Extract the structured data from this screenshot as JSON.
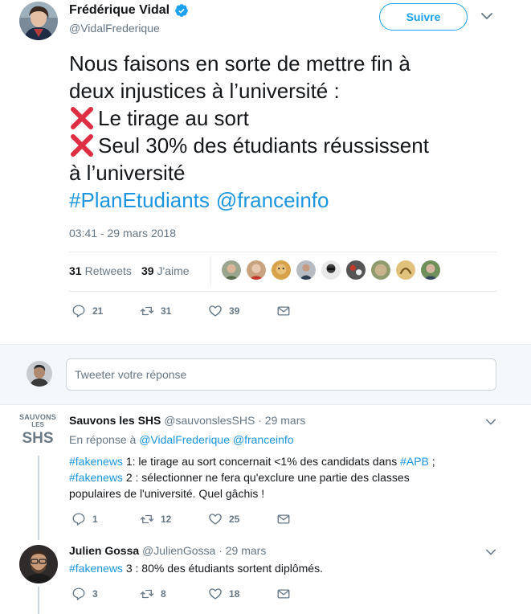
{
  "main_tweet": {
    "author_name": "Frédérique Vidal",
    "author_handle": "@VidalFrederique",
    "follow_label": "Suivre",
    "text_lines": [
      "Nous faisons en sorte de mettre fin à",
      "deux injustices à l’université :",
      "Le tirage au sort",
      "Seul 30% des étudiants réussissent",
      "à l’université"
    ],
    "hashtags": [
      "#PlanEtudiants",
      "@franceinfo"
    ],
    "timestamp": "03:41 - 29 mars 2018",
    "retweets_count": "31",
    "retweets_label": "Retweets",
    "likes_count": "39",
    "likes_label": "J'aime",
    "actions": {
      "replies": "21",
      "retweets": "31",
      "likes": "39"
    }
  },
  "compose": {
    "placeholder": "Tweeter votre réponse"
  },
  "replies": [
    {
      "author_name": "Sauvons les SHS",
      "author_handle": "@sauvonslesSHS",
      "sep": "·",
      "date": "29 mars",
      "reply_to_prefix": "En réponse à",
      "reply_to_1": "@VidalFrederique",
      "reply_to_2": "@franceinfo",
      "logo_line1": "SAUVONS",
      "logo_line2": "LES",
      "logo_line3": "SHS",
      "body": {
        "tag1": "#fakenews",
        "p1": " 1: le tirage au sort concernait <1% des candidats dans ",
        "tag2": "#APB",
        "p2": " ;",
        "tag3": "#fakenews",
        "p3": " 2 : sélectionner ne fera qu'exclure une partie des classes",
        "p4": "populaires de l'université. Quel gâchis !"
      },
      "actions": {
        "replies": "1",
        "retweets": "12",
        "likes": "25"
      }
    },
    {
      "author_name": "Julien Gossa",
      "author_handle": "@JulienGossa",
      "sep": "·",
      "date": "29 mars",
      "body": {
        "tag1": "#fakenews",
        "p1": " 3 : 80% des étudiants sortent diplômés."
      },
      "actions": {
        "replies": "3",
        "retweets": "8",
        "likes": "18"
      }
    }
  ],
  "colors": {
    "link": "#1b95e0",
    "accent": "#1da1f2",
    "muted": "#657786",
    "x_mark": "#dd2e44"
  }
}
